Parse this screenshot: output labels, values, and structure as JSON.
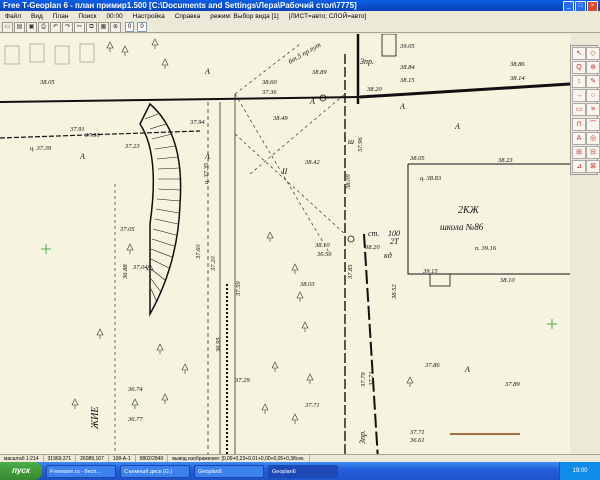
{
  "window": {
    "title": "Free T-Geoplan 6 - план примир1.500 [C:\\Documents and Settings\\Лера\\Рабочий стол\\7775]",
    "min": "_",
    "max": "□",
    "close": "×"
  },
  "menu": [
    "Файл",
    "Вид",
    "План",
    "Поиск",
    "00:00",
    "Настройка",
    "Справка",
    "режим: Выбор вида [1]",
    "[ЛИСТ=авто; СЛОЙ=авто]"
  ],
  "toolbar": {
    "icons": [
      "new-icon",
      "open-icon",
      "save-icon",
      "print-icon",
      "undo-icon",
      "redo-icon",
      "cut-icon",
      "copy-icon",
      "paste-icon",
      "zoom-icon"
    ],
    "field1": "0",
    "field2": "0"
  },
  "palette": [
    "↖",
    "◇",
    "Q",
    "⊕",
    "↕",
    "✎",
    "→",
    "○",
    "▭",
    "≡",
    "⊓",
    "⌒",
    "A",
    "◎",
    "⊞",
    "⊟",
    "⊿",
    "⊠"
  ],
  "map": {
    "elevations": [
      "38.05",
      "37.91",
      "37.50",
      "37.23",
      "ц. 37.39",
      "37.94",
      "38.60",
      "37.36",
      "38.49",
      "38.42",
      "38.89",
      "38.20",
      "38.84",
      "38.86",
      "38.15",
      "38.14",
      "39.05",
      "38.05",
      "38.23",
      "ц. 38.83",
      "37.96",
      "38.09",
      "38.10",
      "38.52",
      "38.20",
      "36.56",
      "38.10",
      "39.15",
      "37.85",
      "38.03",
      "37.05",
      "36.88",
      "37.04",
      "37.60",
      "37.20",
      "37.59",
      "36.95",
      "37.29",
      "36.74",
      "36.77",
      "37.71",
      "37.86",
      "37.89",
      "37.79",
      "37.71",
      "37.71",
      "36.61",
      "п. 39.16",
      "ц. 37.35"
    ],
    "letters": [
      "A",
      "A",
      "A",
      "A",
      "A",
      "A",
      "A",
      "II",
      "ш",
      "ст.",
      "100",
      "2Т",
      "кд",
      "3пр.",
      "3пр."
    ],
    "building_code": "2КЖ",
    "building_name": "школа №86",
    "street_label": "бт.5 пр.пут",
    "road_label": "ЖИЕ"
  },
  "status": [
    "масштаб 1:214",
    "31969,371",
    "26089,167",
    "108-А-1",
    "9802/2840",
    "вывод изображения: [0,09+0,23+0,01+0,00+0,05+0,38сек."
  ],
  "taskbar": {
    "start": "пуск",
    "tasks": [
      "Freeware.ru - бесп...",
      "Съемный диск (G:)",
      "Geoplan6",
      "Geoplan6"
    ],
    "clock": "19:00"
  }
}
